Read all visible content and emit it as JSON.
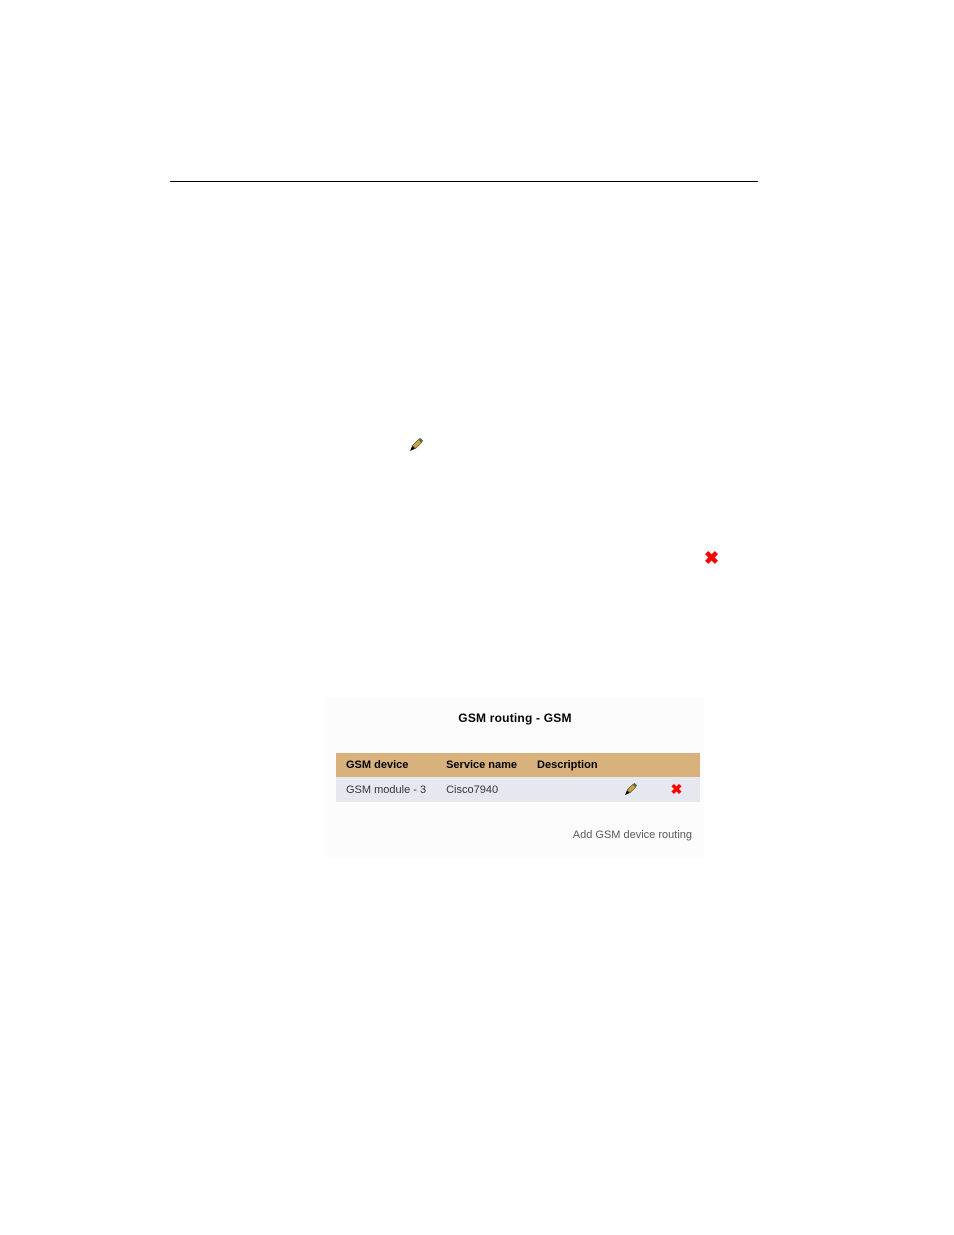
{
  "panel": {
    "title": "GSM routing - GSM",
    "add_link": "Add GSM device routing",
    "headers": {
      "device": "GSM device",
      "service": "Service name",
      "desc": "Description"
    },
    "row": {
      "device": "GSM module - 3",
      "service": "Cisco7940",
      "desc": ""
    }
  },
  "glyphs": {
    "x": "✖"
  }
}
